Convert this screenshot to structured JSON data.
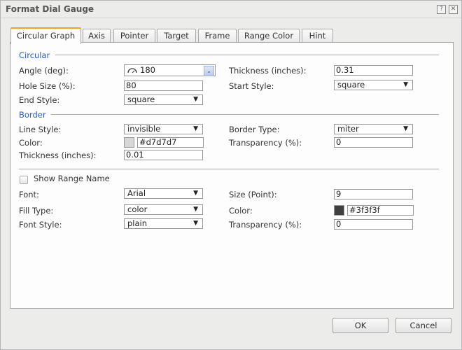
{
  "dialog": {
    "title": "Format Dial Gauge",
    "help_icon": "?",
    "close_icon": "✕"
  },
  "tabs": [
    {
      "label": "Circular Graph",
      "active": true
    },
    {
      "label": "Axis"
    },
    {
      "label": "Pointer"
    },
    {
      "label": "Target"
    },
    {
      "label": "Frame"
    },
    {
      "label": "Range Color"
    },
    {
      "label": "Hint"
    }
  ],
  "circular": {
    "title": "Circular",
    "angle_label": "Angle (deg):",
    "angle_value": "180",
    "thickness_label": "Thickness (inches):",
    "thickness_value": "0.31",
    "hole_size_label": "Hole Size (%):",
    "hole_size_value": "80",
    "start_style_label": "Start Style:",
    "start_style_value": "square",
    "end_style_label": "End Style:",
    "end_style_value": "square"
  },
  "border": {
    "title": "Border",
    "line_style_label": "Line Style:",
    "line_style_value": "invisible",
    "border_type_label": "Border Type:",
    "border_type_value": "miter",
    "color_label": "Color:",
    "color_value": "#d7d7d7",
    "transparency_label": "Transparency (%):",
    "transparency_value": "0",
    "thickness_label": "Thickness (inches):",
    "thickness_value": "0.01"
  },
  "range_name": {
    "show_label": "Show Range Name",
    "show_checked": false,
    "font_label": "Font:",
    "font_value": "Arial",
    "size_label": "Size (Point):",
    "size_value": "9",
    "fill_type_label": "Fill Type:",
    "fill_type_value": "color",
    "color_label": "Color:",
    "color_value": "#3f3f3f",
    "font_style_label": "Font Style:",
    "font_style_value": "plain",
    "transparency_label": "Transparency (%):",
    "transparency_value": "0"
  },
  "buttons": {
    "ok": "OK",
    "cancel": "Cancel"
  },
  "dropdown_arrow": "▼"
}
